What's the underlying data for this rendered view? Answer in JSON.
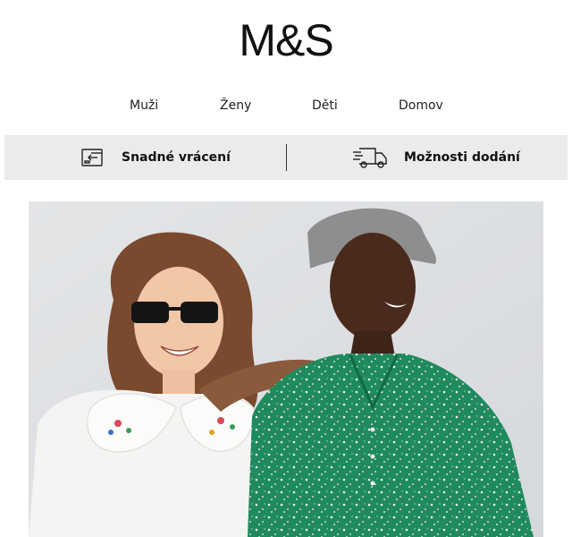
{
  "brand": {
    "logo_text": "M&S"
  },
  "nav": {
    "items": [
      {
        "label": "Muži"
      },
      {
        "label": "Ženy"
      },
      {
        "label": "Děti"
      },
      {
        "label": "Domov"
      }
    ]
  },
  "services": {
    "returns": {
      "label": "Snadné vrácení",
      "icon": "return-box-icon"
    },
    "delivery": {
      "label": "Možnosti dodání",
      "icon": "delivery-truck-icon"
    }
  },
  "hero": {
    "image_subject": "two-women-smiling-photo",
    "colors": {
      "background": "#e4e6e8",
      "green_dress": "#1f8a5e",
      "white_blouse": "#f4f4f2"
    }
  }
}
